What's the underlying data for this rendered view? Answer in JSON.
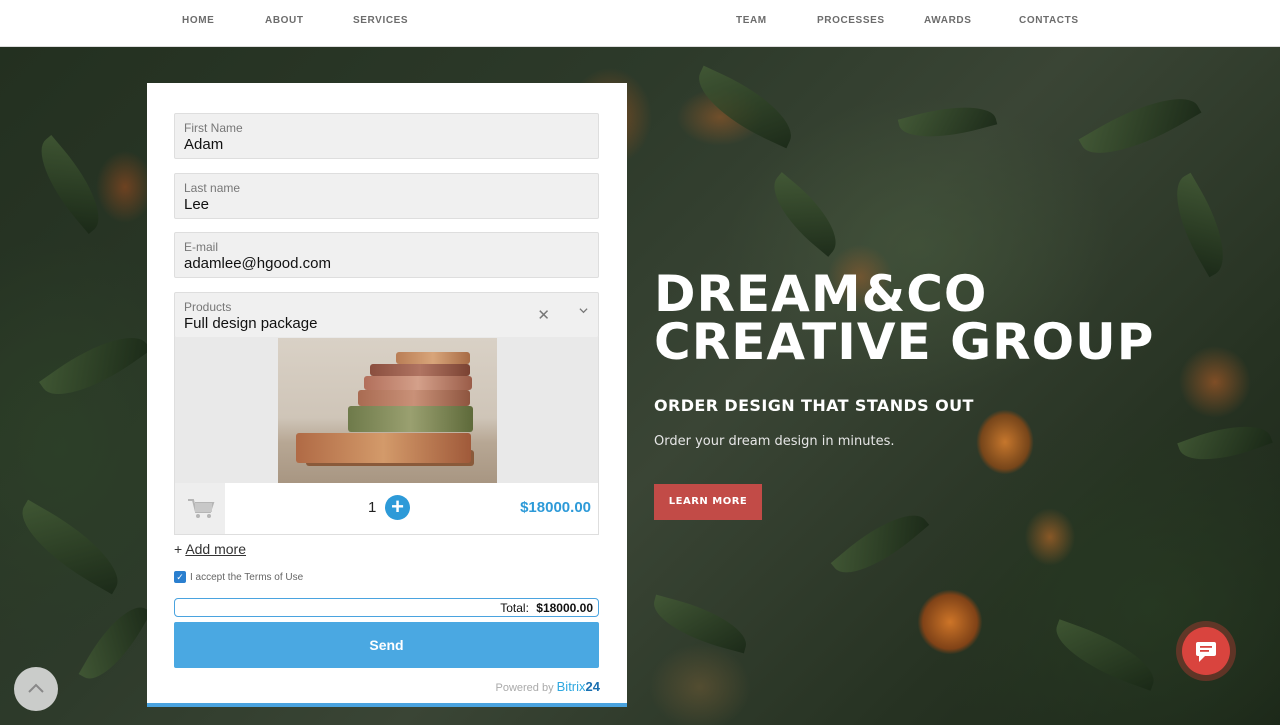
{
  "nav": {
    "items": [
      "HOME",
      "ABOUT",
      "SERVICES",
      "TEAM",
      "PROCESSES",
      "AWARDS",
      "CONTACTS"
    ]
  },
  "form": {
    "first_name": {
      "label": "First Name",
      "value": "Adam"
    },
    "last_name": {
      "label": "Last name",
      "value": "Lee"
    },
    "email": {
      "label": "E-mail",
      "value": "adamlee@hgood.com"
    },
    "products": {
      "label": "Products",
      "value": "Full design package"
    },
    "cart": {
      "quantity": "1",
      "price": "$18000.00"
    },
    "add_more": "Add more",
    "terms": "I accept the Terms of Use",
    "terms_checked": true,
    "total_label": "Total:",
    "total_value": "$18000.00",
    "send_label": "Send",
    "powered_by": "Powered by",
    "powered_brand": "Bitrix",
    "powered_brand_num": "24"
  },
  "hero": {
    "title_line1": "DREAM&CO",
    "title_line2": "CREATIVE GROUP",
    "subtitle": "ORDER DESIGN THAT STANDS OUT",
    "tagline": "Order your dream design in minutes.",
    "cta": "LEARN MORE"
  },
  "icons": {
    "scroll_top": "chevron-up-icon",
    "chat": "chat-bubble-icon",
    "cart": "shopping-cart-icon"
  },
  "colors": {
    "accent_blue": "#4aa8e2",
    "price_blue": "#2d9ad8",
    "cta_red": "#c24b47",
    "chat_red": "#d9443e"
  }
}
